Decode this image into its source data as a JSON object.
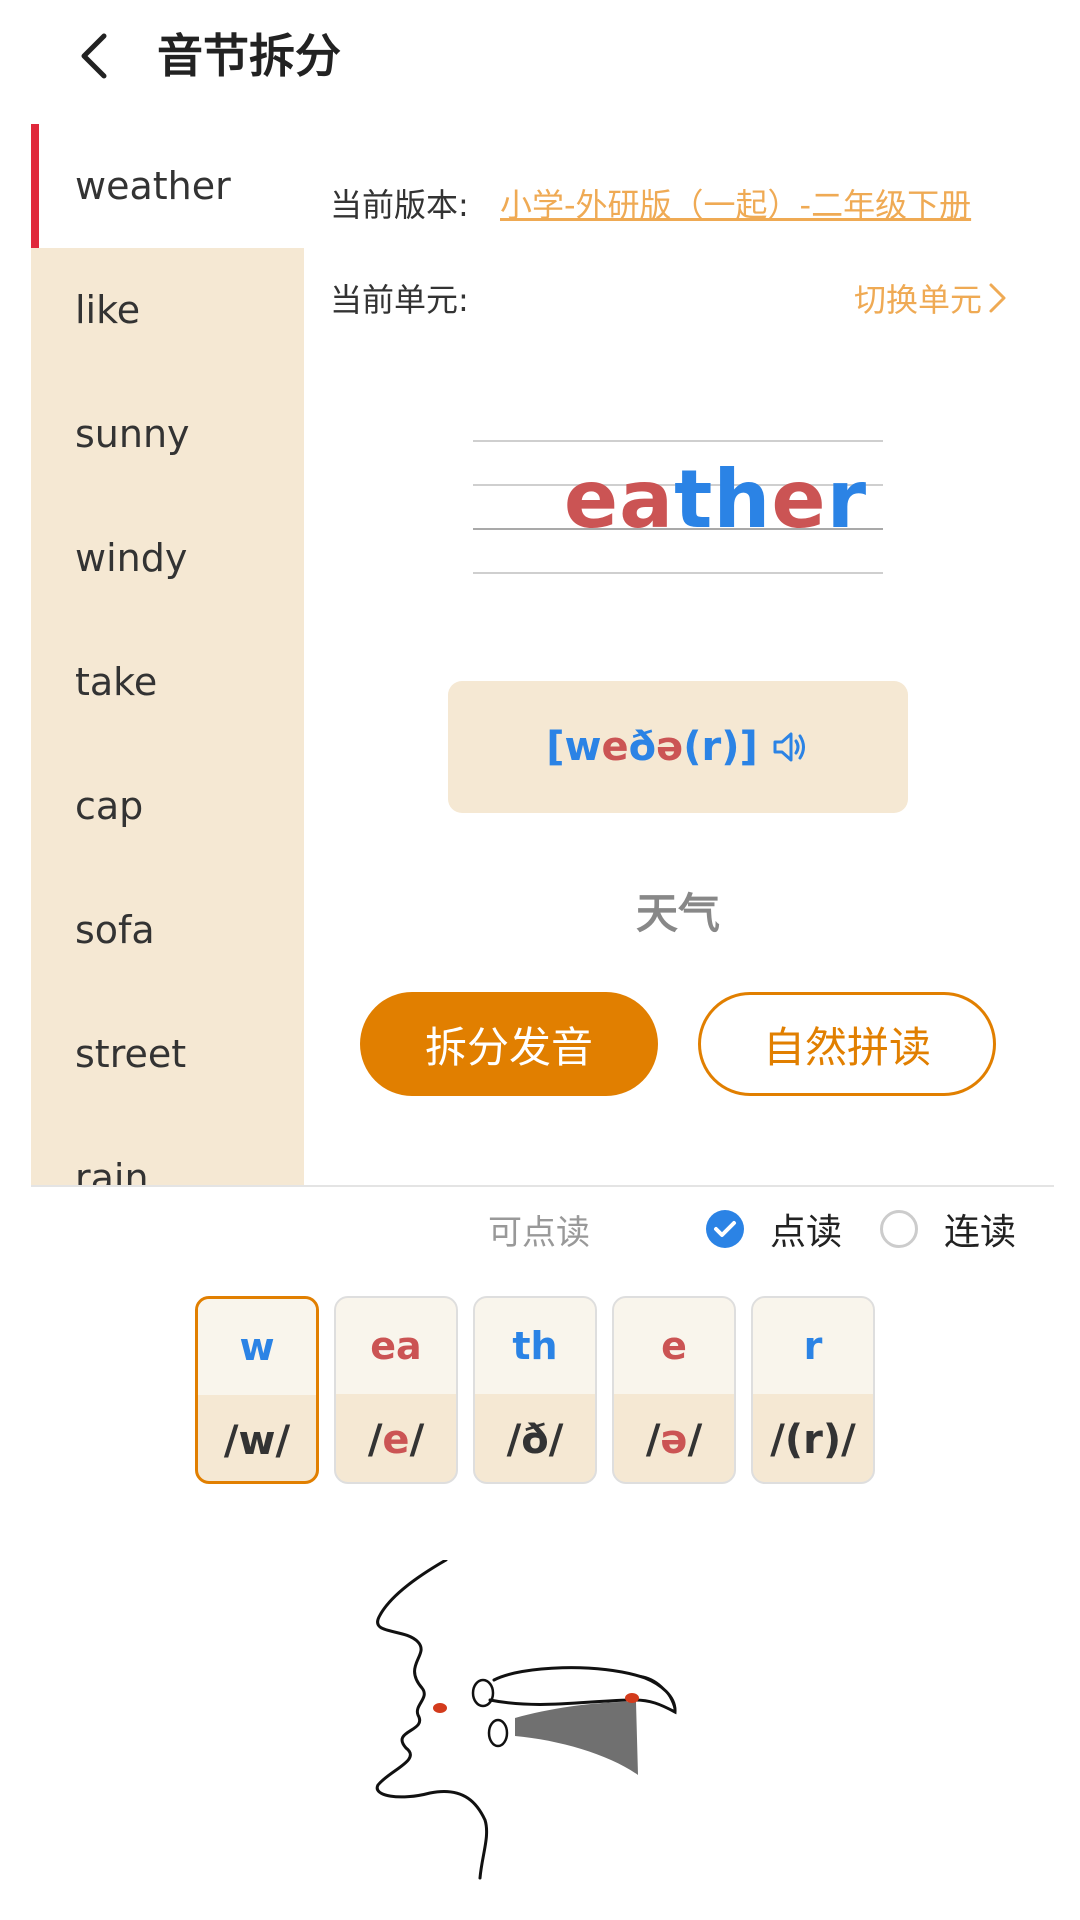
{
  "header": {
    "title": "音节拆分"
  },
  "sidebar": {
    "items": [
      {
        "label": "weather"
      },
      {
        "label": "like"
      },
      {
        "label": "sunny"
      },
      {
        "label": "windy"
      },
      {
        "label": "take"
      },
      {
        "label": "cap"
      },
      {
        "label": "sofa"
      },
      {
        "label": "street"
      },
      {
        "label": "rain"
      }
    ]
  },
  "info": {
    "version_label": "当前版本:",
    "version_value": "小学-外研版（一起）-二年级下册",
    "unit_label": "当前单元:",
    "switch_unit": "切换单元"
  },
  "word": {
    "parts": [
      {
        "text": "ea",
        "color": "red"
      },
      {
        "text": "th",
        "color": "blue"
      },
      {
        "text": "e",
        "color": "red"
      },
      {
        "text": "r",
        "color": "blue"
      }
    ]
  },
  "phonetic": {
    "parts": [
      {
        "text": "[w",
        "color": "blue"
      },
      {
        "text": "e",
        "color": "red"
      },
      {
        "text": "ð",
        "color": "blue"
      },
      {
        "text": "ə",
        "color": "red"
      },
      {
        "text": "(r)]",
        "color": "blue"
      }
    ]
  },
  "meaning": "天气",
  "buttons": {
    "split": "拆分发音",
    "natural": "自然拼读"
  },
  "read_mode": {
    "hint": "可点读",
    "option1": "点读",
    "option2": "连读",
    "selected": "点读"
  },
  "phonemes": [
    {
      "letters": "w",
      "letter_color": "blue",
      "ipa": "/w/",
      "selected": true
    },
    {
      "letters": "ea",
      "letter_color": "red",
      "ipa_pre": "/",
      "ipa_mid": "e",
      "ipa_post": "/",
      "selected": false
    },
    {
      "letters": "th",
      "letter_color": "blue",
      "ipa": "/ð/",
      "selected": false
    },
    {
      "letters": "e",
      "letter_color": "red",
      "ipa_pre": "/",
      "ipa_mid": "ə",
      "ipa_post": "/",
      "selected": false
    },
    {
      "letters": "r",
      "letter_color": "blue",
      "ipa": "/(r)/",
      "selected": false
    }
  ],
  "colors": {
    "accent": "#e17f00",
    "red": "#cb5454",
    "blue": "#2b83e5",
    "sidebar_bg": "#f5e8d3",
    "active_marker": "#e0283b",
    "link": "#efaa54"
  }
}
